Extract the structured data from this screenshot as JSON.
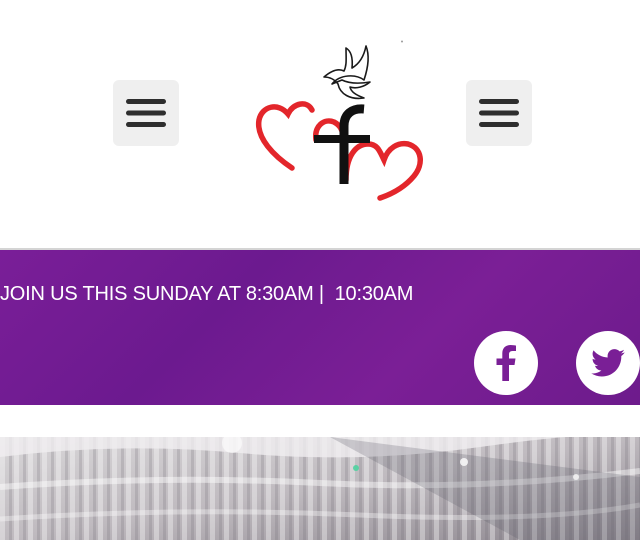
{
  "header": {
    "logo_icon": "mfm-dove-hearts-logo",
    "menu_icon": "hamburger-menu-icon"
  },
  "banner": {
    "announcement": "JOIN US THIS SUNDAY AT 8:30AM |  10:30AM",
    "background_color": "#731c92",
    "social": [
      {
        "icon": "facebook-icon"
      },
      {
        "icon": "twitter-icon"
      }
    ]
  },
  "hero": {
    "image": "event-hall-ceiling-with-draped-fabric"
  }
}
